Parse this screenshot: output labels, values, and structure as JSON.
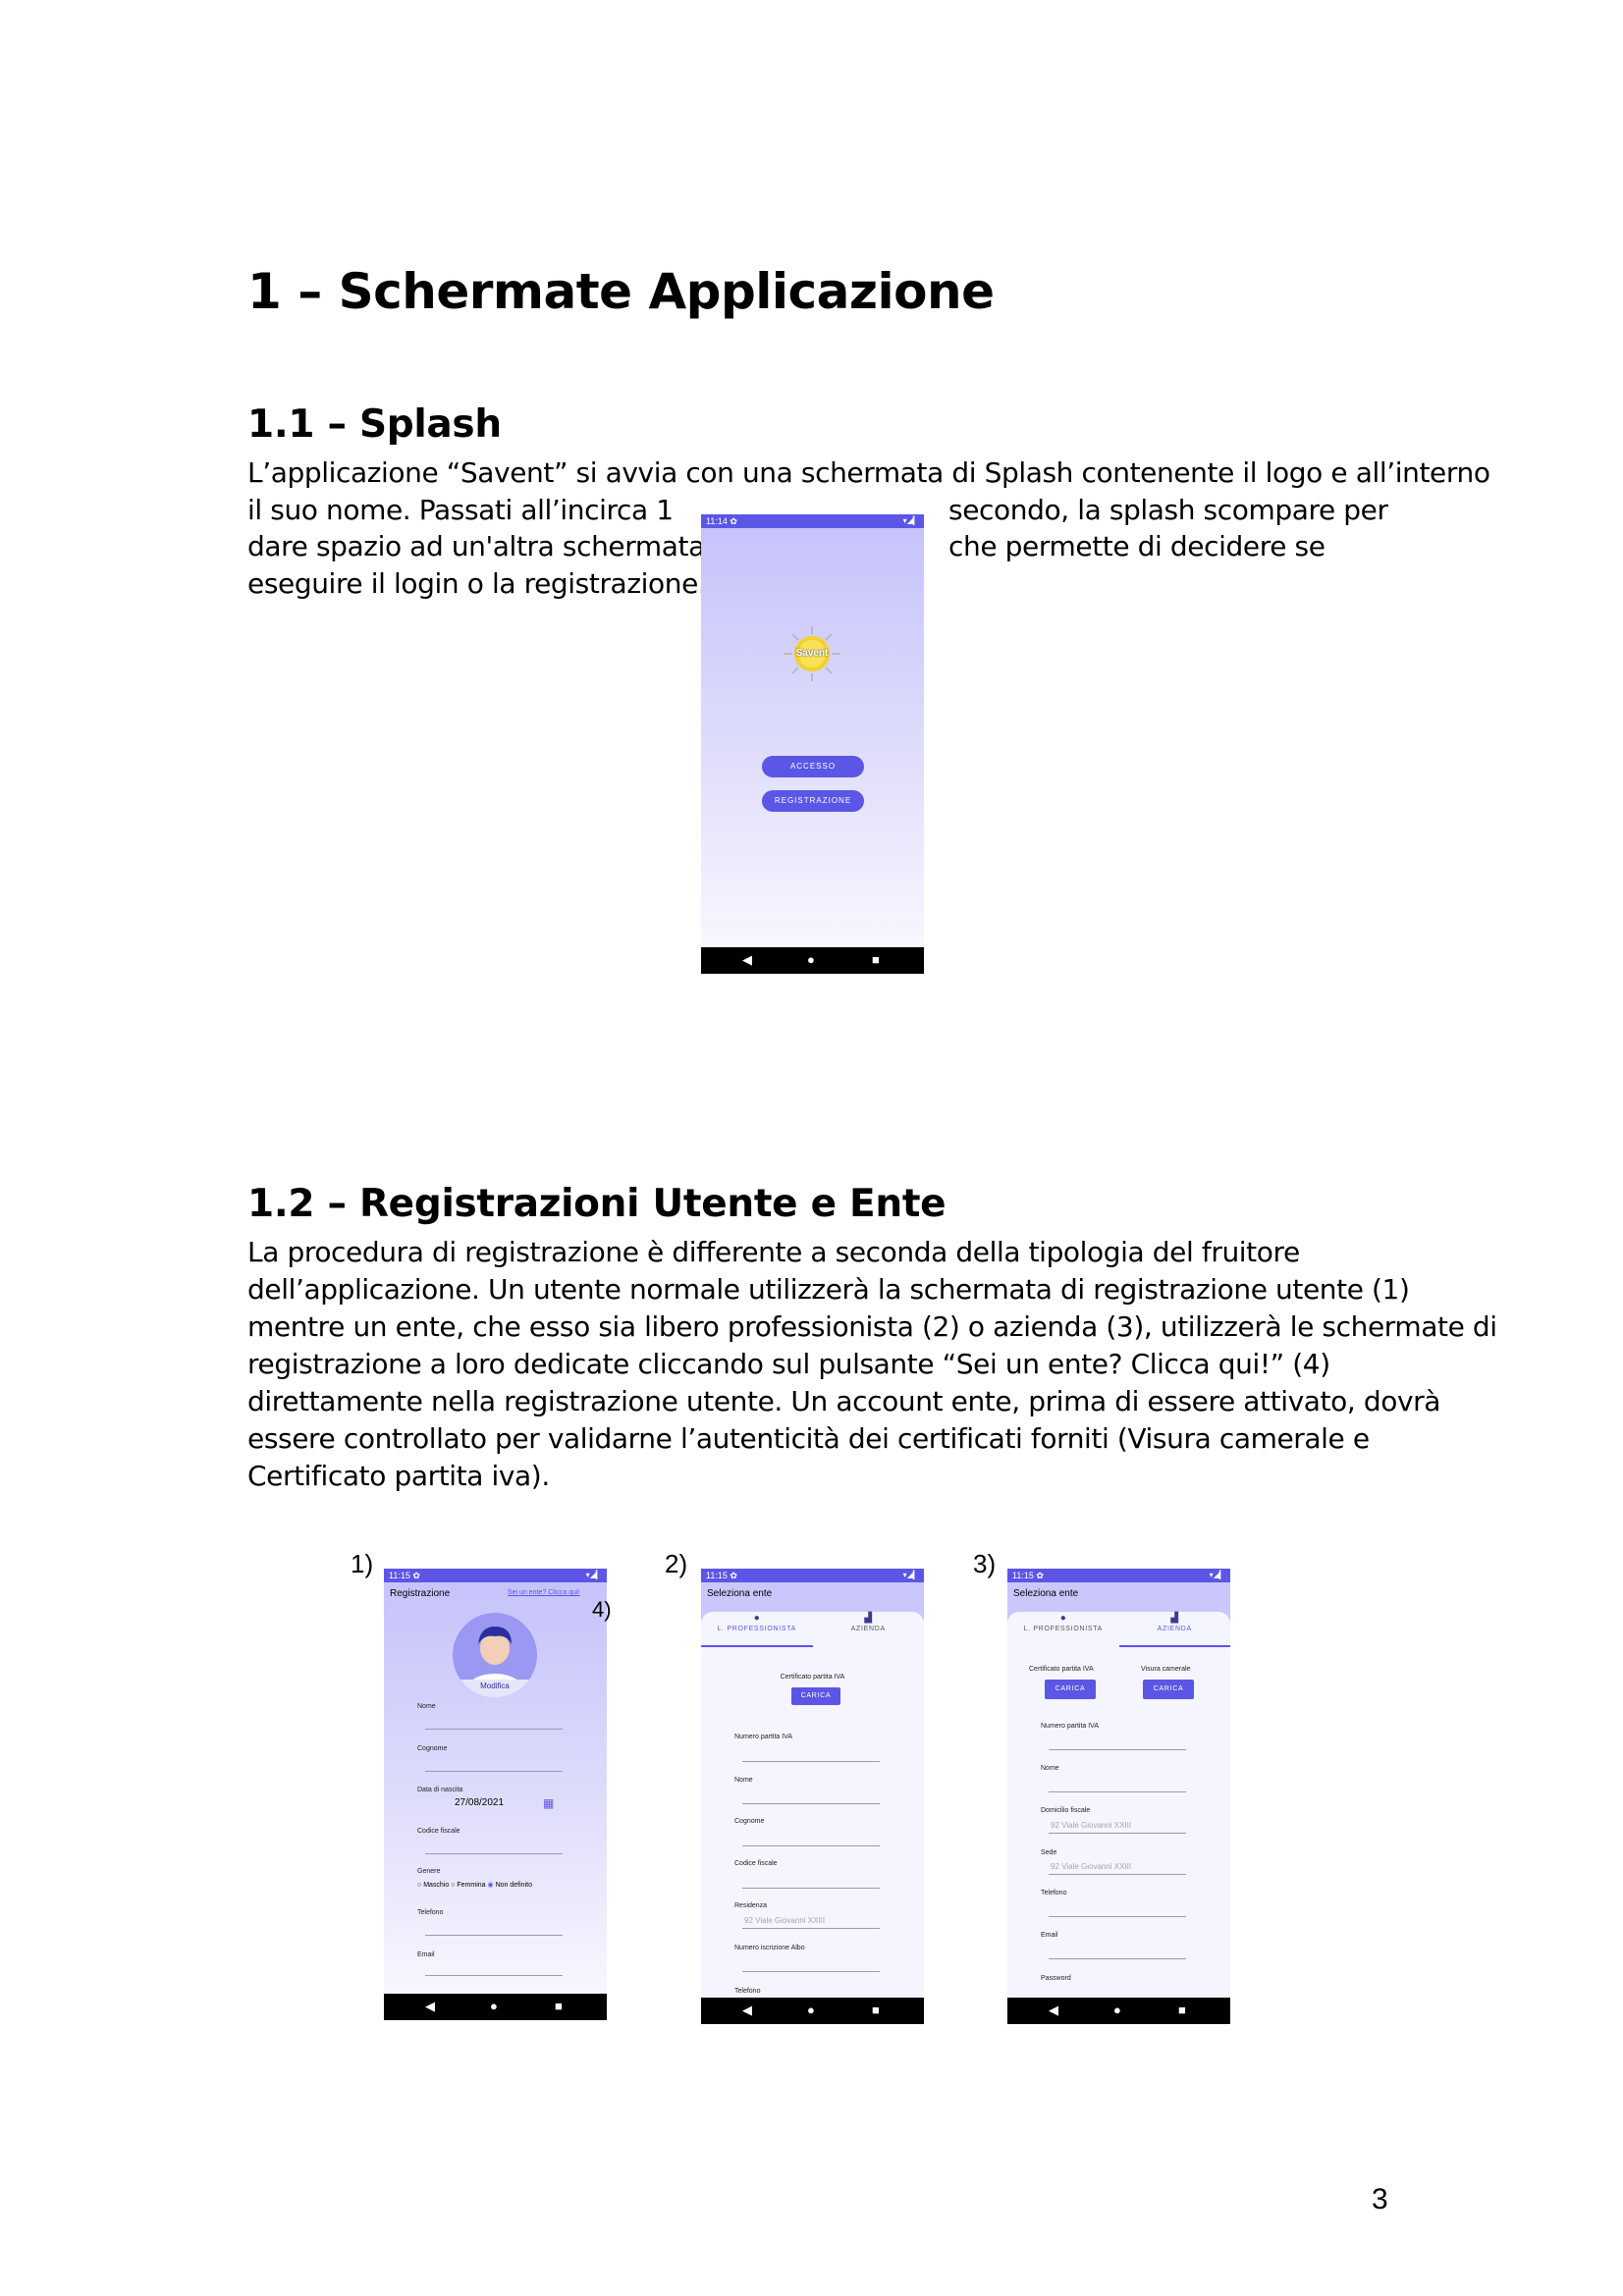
{
  "heading": "1 – Schermate Applicazione",
  "splash_section": {
    "title": "1.1 – Splash",
    "lines": [
      "L’applicazione “Savent” si avvia con una schermata di Splash contenente il logo e all’interno",
      "il suo nome. Passati all’incirca 1",
      "dare spazio ad un'altra schermata",
      "eseguire il login o la registrazione.",
      "secondo, la splash scompare per",
      "che permette di decidere se"
    ]
  },
  "splash_phone": {
    "time": "11:14",
    "status_icons": "▾◢▎",
    "logo_text": "Savent",
    "buttons": [
      "ACCESSO",
      "REGISTRAZIONE"
    ],
    "nav": [
      "◀",
      "●",
      "■"
    ]
  },
  "registration_section": {
    "title": "1.2 – Registrazioni Utente e Ente",
    "lines": [
      "La procedura di registrazione è differente a seconda della tipologia del fruitore",
      "dell’applicazione. Un utente normale utilizzerà la schermata di registrazione utente (1)",
      "mentre un ente, che esso sia libero professionista (2) o azienda (3), utilizzerà le schermate di",
      "registrazione a loro dedicate cliccando sul pulsante “Sei un ente? Clicca qui!” (4)",
      "direttamente nella registrazione utente. Un account ente, prima di essere attivato, dovrà",
      "essere controllato per validarne l’autenticità dei certificati forniti (Visura camerale e",
      "Certificato partita iva)."
    ]
  },
  "captions": [
    "1)",
    "2)",
    "3)",
    "4)"
  ],
  "phone1": {
    "time": "11:15",
    "title": "Registrazione",
    "ente_link": "Sei un ente? Clicca qui!",
    "edit_label": "Modifica",
    "fields": [
      "Nome",
      "Cognome",
      "Data di nascita",
      "Codice fiscale",
      "Genere",
      "Telefono",
      "Email"
    ],
    "date_value": "27/08/2021",
    "gender_options": [
      "Maschio",
      "Femmina",
      "Non definito"
    ]
  },
  "phone2": {
    "time": "11:15",
    "title": "Seleziona ente",
    "tabs": [
      "L. PROFESSIONISTA",
      "AZIENDA"
    ],
    "upload_label": "Certificato partita IVA",
    "upload_button": "CARICA",
    "fields": [
      "Numero partita IVA",
      "Nome",
      "Cognome",
      "Codice fiscale",
      "Residenza",
      "Numero iscrizione Albo",
      "Telefono"
    ],
    "address_placeholder": "92 Viale Giovanni XXIII"
  },
  "phone3": {
    "time": "11:15",
    "title": "Seleziona ente",
    "tabs": [
      "L. PROFESSIONISTA",
      "AZIENDA"
    ],
    "upload_labels": [
      "Certificato partita IVA",
      "Visura camerale"
    ],
    "upload_button": "CARICA",
    "fields": [
      "Numero partita IVA",
      "Nome",
      "Domicilio fiscale",
      "Sede",
      "Telefono",
      "Email",
      "Password"
    ],
    "address_placeholder": "92 Viale Giovanni XXIII"
  },
  "page_number": "3"
}
